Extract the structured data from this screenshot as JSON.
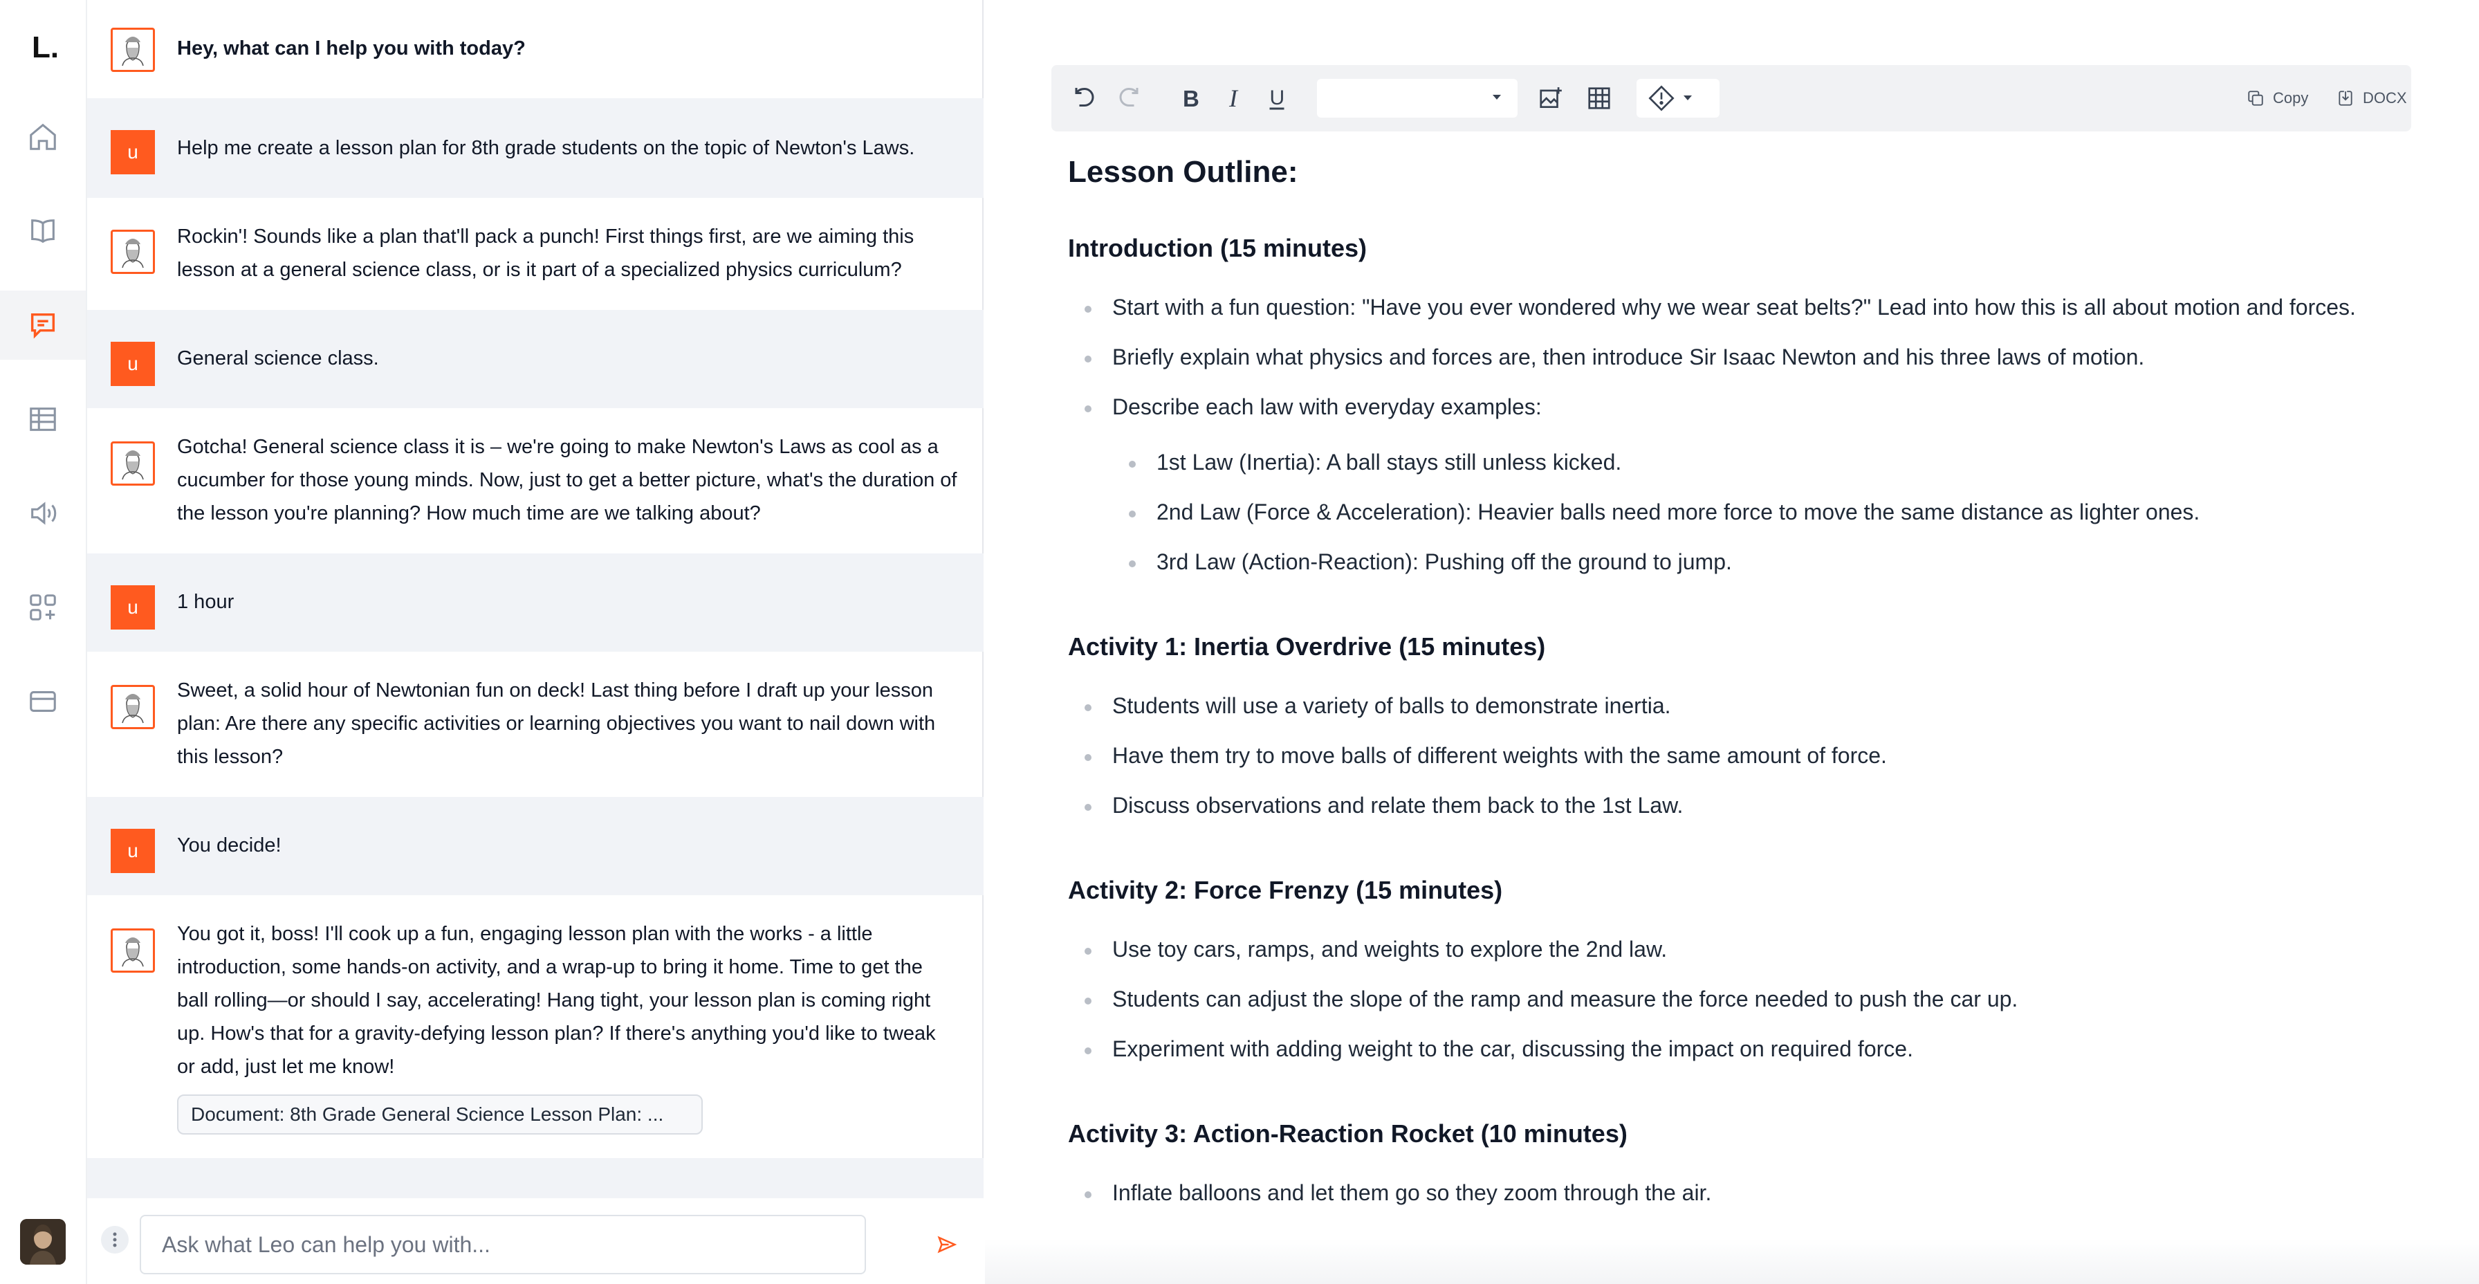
{
  "app": {
    "logo_text": "L.",
    "accent_color": "#ff5a1f"
  },
  "rail": {
    "items": [
      {
        "icon": "home-icon"
      },
      {
        "icon": "book-icon"
      },
      {
        "icon": "chat-icon",
        "active": true
      },
      {
        "icon": "table-icon"
      },
      {
        "icon": "speaker-icon"
      },
      {
        "icon": "apps-icon"
      },
      {
        "icon": "card-icon"
      }
    ]
  },
  "chat": {
    "user_avatar_letter": "u",
    "messages": [
      {
        "role": "bot",
        "text": "Hey, what can I help you with today?"
      },
      {
        "role": "user",
        "text": "Help me create a lesson plan for 8th grade students on the topic of Newton's Laws."
      },
      {
        "role": "bot",
        "text": "Rockin'! Sounds like a plan that'll pack a punch! First things first, are we aiming this lesson at a general science class, or is it part of a specialized physics curriculum?"
      },
      {
        "role": "user",
        "text": "General science class."
      },
      {
        "role": "bot",
        "text": "Gotcha! General science class it is – we're going to make Newton's Laws as cool as a cucumber for those young minds. Now, just to get a better picture, what's the duration of the lesson you're planning? How much time are we talking about?"
      },
      {
        "role": "user",
        "text": "1 hour"
      },
      {
        "role": "bot",
        "text": "Sweet, a solid hour of Newtonian fun on deck! Last thing before I draft up your lesson plan: Are there any specific activities or learning objectives you want to nail down with this lesson?"
      },
      {
        "role": "user",
        "text": "You decide!"
      },
      {
        "role": "bot",
        "text": "You got it, boss! I'll cook up a fun, engaging lesson plan with the works - a little introduction, some hands-on activity, and a wrap-up to bring it home. Time to get the ball rolling—or should I say, accelerating! Hang tight, your lesson plan is coming right up. How's that for a gravity-defying lesson plan? If there's anything you'd like to tweak or add, just let me know!"
      }
    ],
    "document_chip": "Document: 8th Grade General Science Lesson Plan: ...",
    "input_placeholder": "Ask what Leo can help you with..."
  },
  "toolbar": {
    "copy_label": "Copy",
    "docx_label": "DOCX"
  },
  "document": {
    "title": "Lesson Outline:",
    "sections": [
      {
        "heading": "Introduction (15 minutes)",
        "items": [
          "Start with a fun question: \"Have you ever wondered why we wear seat belts?\" Lead into how this is all about motion and forces.",
          "Briefly explain what physics and forces are, then introduce Sir Isaac Newton and his three laws of motion.",
          "Describe each law with everyday examples:"
        ],
        "subitems": [
          "1st Law (Inertia): A ball stays still unless kicked.",
          "2nd Law (Force & Acceleration): Heavier balls need more force to move the same distance as lighter ones.",
          "3rd Law (Action-Reaction): Pushing off the ground to jump."
        ]
      },
      {
        "heading": "Activity 1: Inertia Overdrive (15 minutes)",
        "items": [
          "Students will use a variety of balls to demonstrate inertia.",
          "Have them try to move balls of different weights with the same amount of force.",
          "Discuss observations and relate them back to the 1st Law."
        ]
      },
      {
        "heading": "Activity 2: Force Frenzy (15 minutes)",
        "items": [
          "Use toy cars, ramps, and weights to explore the 2nd law.",
          "Students can adjust the slope of the ramp and measure the force needed to push the car up.",
          "Experiment with adding weight to the car, discussing the impact on required force."
        ]
      },
      {
        "heading": "Activity 3: Action-Reaction Rocket (10 minutes)",
        "items": [
          "Inflate balloons and let them go so they zoom through the air."
        ]
      }
    ]
  }
}
